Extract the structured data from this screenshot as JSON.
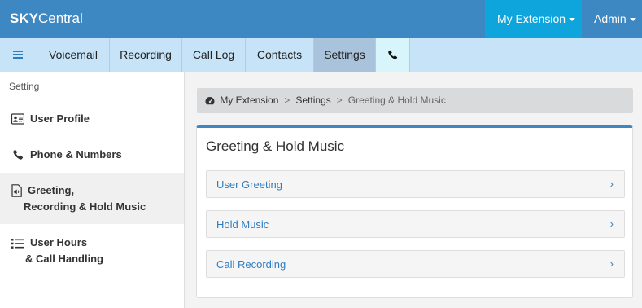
{
  "topbar": {
    "brand_strong": "SKY",
    "brand_rest": "Central",
    "my_extension_label": "My Extension",
    "admin_label": "Admin"
  },
  "nav": {
    "menu_icon": "hamburger-icon",
    "tabs": [
      {
        "label": "Voicemail"
      },
      {
        "label": "Recording"
      },
      {
        "label": "Call Log"
      },
      {
        "label": "Contacts"
      },
      {
        "label": "Settings"
      }
    ],
    "phone_icon": "phone-icon",
    "active_tab": "Settings"
  },
  "sidebar": {
    "heading": "Setting",
    "items": [
      {
        "icon": "id-card-icon",
        "line1": "User Profile",
        "line2": ""
      },
      {
        "icon": "phone-icon",
        "line1": "Phone & Numbers",
        "line2": ""
      },
      {
        "icon": "audio-file-icon",
        "line1": "Greeting,",
        "line2": "Recording & Hold Music"
      },
      {
        "icon": "list-icon",
        "line1": "User Hours",
        "line2": "& Call Handling"
      }
    ],
    "active_item": "Greeting, Recording & Hold Music"
  },
  "breadcrumb": {
    "icon": "dashboard-icon",
    "items": [
      "My Extension",
      "Settings",
      "Greeting & Hold Music"
    ],
    "separator": ">"
  },
  "panel": {
    "title": "Greeting & Hold Music",
    "rows": [
      {
        "label": "User Greeting"
      },
      {
        "label": "Hold Music"
      },
      {
        "label": "Call Recording"
      }
    ],
    "chevron": "›"
  },
  "colors": {
    "topbar": "#3d87c2",
    "my_extension_bg": "#0ea5dd",
    "navbar": "#c6e3f7",
    "link": "#2f7dc1"
  }
}
